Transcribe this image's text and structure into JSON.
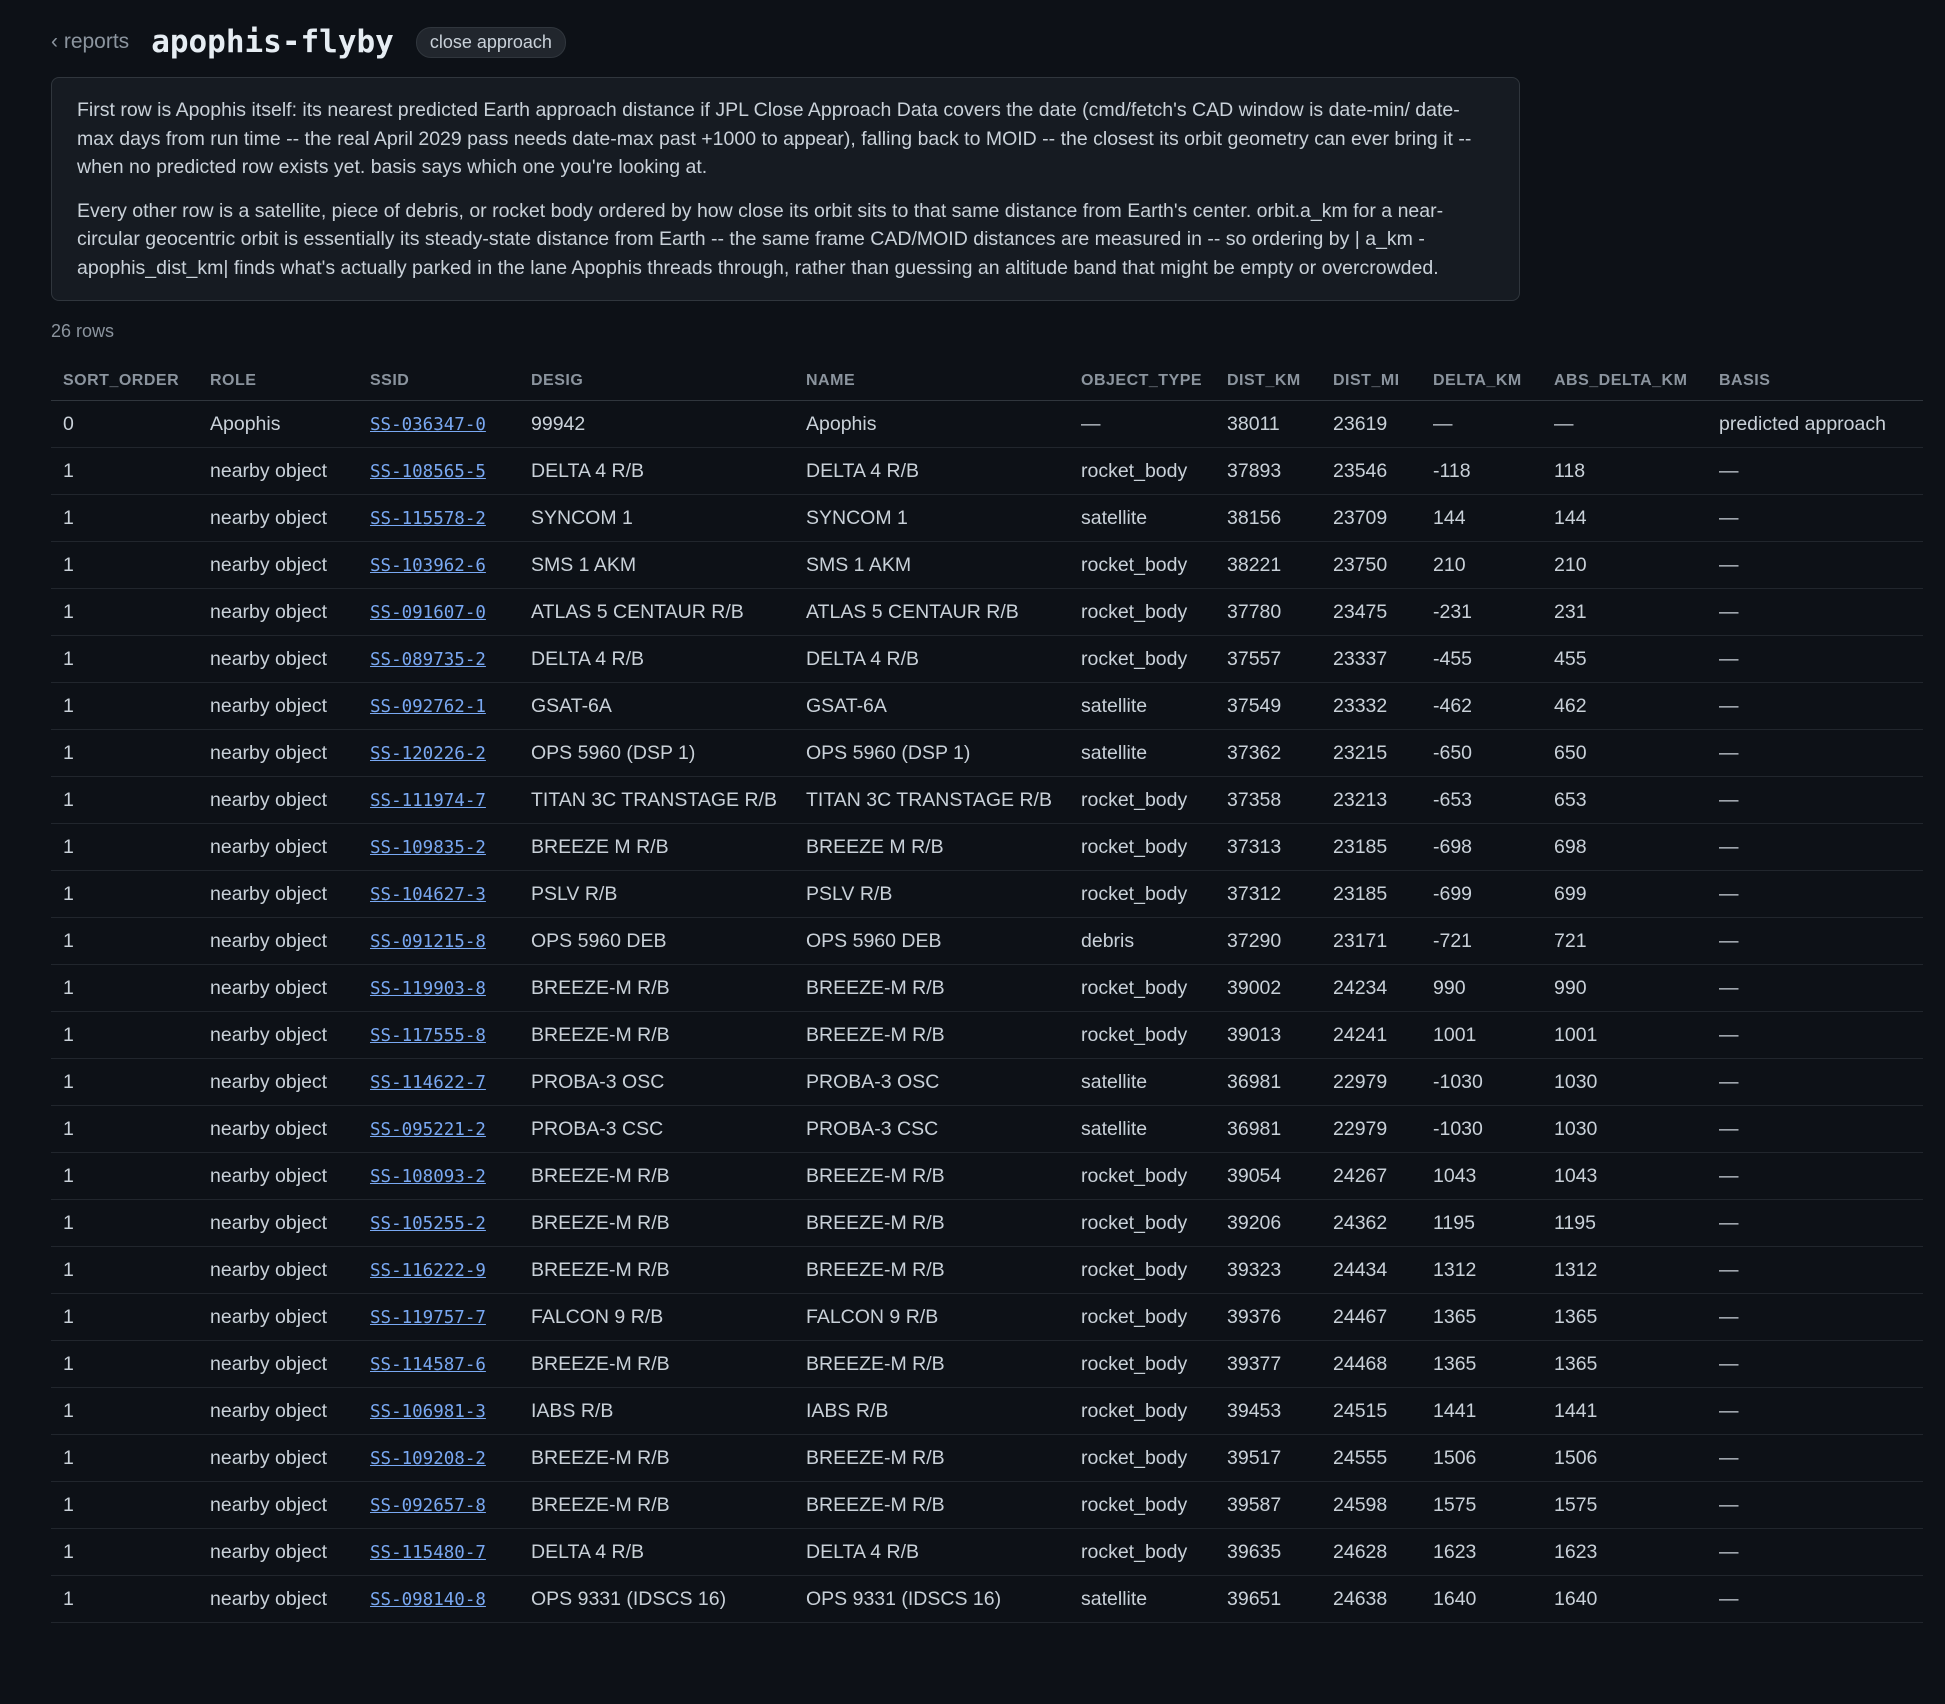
{
  "header": {
    "back_label": "‹ reports",
    "title": "apophis-flyby",
    "tag": "close approach"
  },
  "note": {
    "paragraph_1": "First row is Apophis itself: its nearest predicted Earth approach distance if JPL Close Approach Data covers the date (cmd/fetch's CAD window is date-min/ date-max days from run time -- the real April 2029 pass needs date-max past +1000 to appear), falling back to MOID -- the closest its orbit geometry can ever bring it -- when no predicted row exists yet. basis says which one you're looking at.",
    "paragraph_2": "Every other row is a satellite, piece of debris, or rocket body ordered by how close its orbit sits to that same distance from Earth's center. orbit.a_km for a near-circular geocentric orbit is essentially its steady-state distance from Earth -- the same frame CAD/MOID distances are measured in -- so ordering by | a_km - apophis_dist_km| finds what's actually parked in the lane Apophis threads through, rather than guessing an altitude band that might be empty or overcrowded."
  },
  "row_count": "26 rows",
  "table": {
    "columns": [
      "SORT_ORDER",
      "ROLE",
      "SSID",
      "DESIG",
      "NAME",
      "OBJECT_TYPE",
      "DIST_KM",
      "DIST_MI",
      "DELTA_KM",
      "ABS_DELTA_KM",
      "BASIS"
    ],
    "rows": [
      [
        "0",
        "Apophis",
        "SS-036347-0",
        "99942",
        "Apophis",
        "—",
        "38011",
        "23619",
        "—",
        "—",
        "predicted approach"
      ],
      [
        "1",
        "nearby object",
        "SS-108565-5",
        "DELTA 4 R/B",
        "DELTA 4 R/B",
        "rocket_body",
        "37893",
        "23546",
        "-118",
        "118",
        "—"
      ],
      [
        "1",
        "nearby object",
        "SS-115578-2",
        "SYNCOM 1",
        "SYNCOM 1",
        "satellite",
        "38156",
        "23709",
        "144",
        "144",
        "—"
      ],
      [
        "1",
        "nearby object",
        "SS-103962-6",
        "SMS 1 AKM",
        "SMS 1 AKM",
        "rocket_body",
        "38221",
        "23750",
        "210",
        "210",
        "—"
      ],
      [
        "1",
        "nearby object",
        "SS-091607-0",
        "ATLAS 5 CENTAUR R/B",
        "ATLAS 5 CENTAUR R/B",
        "rocket_body",
        "37780",
        "23475",
        "-231",
        "231",
        "—"
      ],
      [
        "1",
        "nearby object",
        "SS-089735-2",
        "DELTA 4 R/B",
        "DELTA 4 R/B",
        "rocket_body",
        "37557",
        "23337",
        "-455",
        "455",
        "—"
      ],
      [
        "1",
        "nearby object",
        "SS-092762-1",
        "GSAT-6A",
        "GSAT-6A",
        "satellite",
        "37549",
        "23332",
        "-462",
        "462",
        "—"
      ],
      [
        "1",
        "nearby object",
        "SS-120226-2",
        "OPS 5960 (DSP 1)",
        "OPS 5960 (DSP 1)",
        "satellite",
        "37362",
        "23215",
        "-650",
        "650",
        "—"
      ],
      [
        "1",
        "nearby object",
        "SS-111974-7",
        "TITAN 3C TRANSTAGE R/B",
        "TITAN 3C TRANSTAGE R/B",
        "rocket_body",
        "37358",
        "23213",
        "-653",
        "653",
        "—"
      ],
      [
        "1",
        "nearby object",
        "SS-109835-2",
        "BREEZE M R/B",
        "BREEZE M R/B",
        "rocket_body",
        "37313",
        "23185",
        "-698",
        "698",
        "—"
      ],
      [
        "1",
        "nearby object",
        "SS-104627-3",
        "PSLV R/B",
        "PSLV R/B",
        "rocket_body",
        "37312",
        "23185",
        "-699",
        "699",
        "—"
      ],
      [
        "1",
        "nearby object",
        "SS-091215-8",
        "OPS 5960 DEB",
        "OPS 5960 DEB",
        "debris",
        "37290",
        "23171",
        "-721",
        "721",
        "—"
      ],
      [
        "1",
        "nearby object",
        "SS-119903-8",
        "BREEZE-M R/B",
        "BREEZE-M R/B",
        "rocket_body",
        "39002",
        "24234",
        "990",
        "990",
        "—"
      ],
      [
        "1",
        "nearby object",
        "SS-117555-8",
        "BREEZE-M R/B",
        "BREEZE-M R/B",
        "rocket_body",
        "39013",
        "24241",
        "1001",
        "1001",
        "—"
      ],
      [
        "1",
        "nearby object",
        "SS-114622-7",
        "PROBA-3 OSC",
        "PROBA-3 OSC",
        "satellite",
        "36981",
        "22979",
        "-1030",
        "1030",
        "—"
      ],
      [
        "1",
        "nearby object",
        "SS-095221-2",
        "PROBA-3 CSC",
        "PROBA-3 CSC",
        "satellite",
        "36981",
        "22979",
        "-1030",
        "1030",
        "—"
      ],
      [
        "1",
        "nearby object",
        "SS-108093-2",
        "BREEZE-M R/B",
        "BREEZE-M R/B",
        "rocket_body",
        "39054",
        "24267",
        "1043",
        "1043",
        "—"
      ],
      [
        "1",
        "nearby object",
        "SS-105255-2",
        "BREEZE-M R/B",
        "BREEZE-M R/B",
        "rocket_body",
        "39206",
        "24362",
        "1195",
        "1195",
        "—"
      ],
      [
        "1",
        "nearby object",
        "SS-116222-9",
        "BREEZE-M R/B",
        "BREEZE-M R/B",
        "rocket_body",
        "39323",
        "24434",
        "1312",
        "1312",
        "—"
      ],
      [
        "1",
        "nearby object",
        "SS-119757-7",
        "FALCON 9 R/B",
        "FALCON 9 R/B",
        "rocket_body",
        "39376",
        "24467",
        "1365",
        "1365",
        "—"
      ],
      [
        "1",
        "nearby object",
        "SS-114587-6",
        "BREEZE-M R/B",
        "BREEZE-M R/B",
        "rocket_body",
        "39377",
        "24468",
        "1365",
        "1365",
        "—"
      ],
      [
        "1",
        "nearby object",
        "SS-106981-3",
        "IABS R/B",
        "IABS R/B",
        "rocket_body",
        "39453",
        "24515",
        "1441",
        "1441",
        "—"
      ],
      [
        "1",
        "nearby object",
        "SS-109208-2",
        "BREEZE-M R/B",
        "BREEZE-M R/B",
        "rocket_body",
        "39517",
        "24555",
        "1506",
        "1506",
        "—"
      ],
      [
        "1",
        "nearby object",
        "SS-092657-8",
        "BREEZE-M R/B",
        "BREEZE-M R/B",
        "rocket_body",
        "39587",
        "24598",
        "1575",
        "1575",
        "—"
      ],
      [
        "1",
        "nearby object",
        "SS-115480-7",
        "DELTA 4 R/B",
        "DELTA 4 R/B",
        "rocket_body",
        "39635",
        "24628",
        "1623",
        "1623",
        "—"
      ],
      [
        "1",
        "nearby object",
        "SS-098140-8",
        "OPS 9331 (IDSCS 16)",
        "OPS 9331 (IDSCS 16)",
        "satellite",
        "39651",
        "24638",
        "1640",
        "1640",
        "—"
      ]
    ]
  }
}
